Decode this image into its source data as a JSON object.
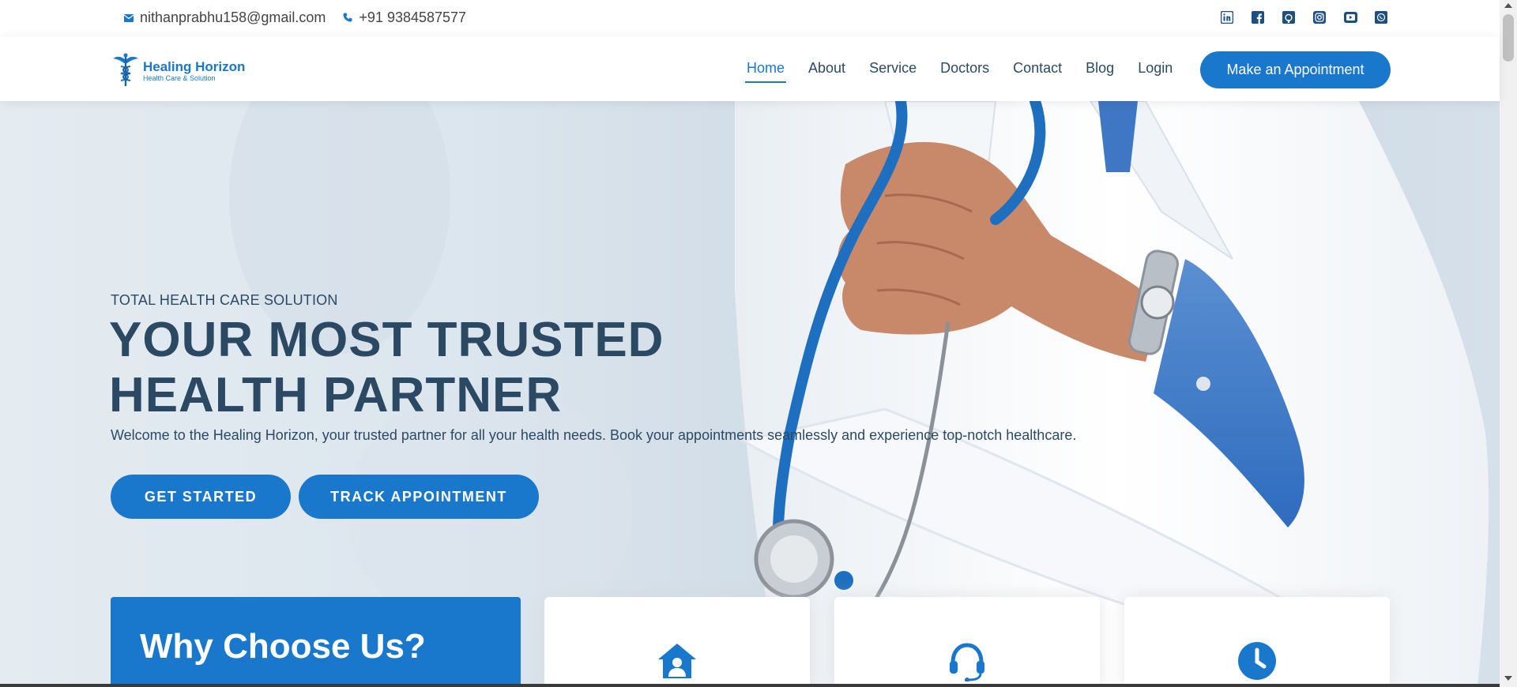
{
  "topbar": {
    "email": "nithanprabhu158@gmail.com",
    "phone": "+91 9384587577",
    "socials": [
      "linkedin-icon",
      "facebook-icon",
      "github-icon",
      "instagram-icon",
      "youtube-icon",
      "whatsapp-icon"
    ]
  },
  "header": {
    "logo_name": "Healing Horizon",
    "logo_tagline": "Health Care & Solution",
    "nav": [
      {
        "label": "Home",
        "active": true
      },
      {
        "label": "About"
      },
      {
        "label": "Service"
      },
      {
        "label": "Doctors"
      },
      {
        "label": "Contact"
      },
      {
        "label": "Blog"
      },
      {
        "label": "Login"
      }
    ],
    "cta": "Make an Appointment"
  },
  "hero": {
    "eyebrow": "TOTAL HEALTH CARE SOLUTION",
    "title_line1": "YOUR MOST TRUSTED",
    "title_line2": "HEALTH PARTNER",
    "lead": "Welcome to the Healing Horizon, your trusted partner for all your health needs. Book your appointments seamlessly and experience top-notch healthcare.",
    "btn_start": "GET STARTED",
    "btn_track": "TRACK APPOINTMENT"
  },
  "why": {
    "title": "Why Choose Us?",
    "cards": [
      "home-user-icon",
      "headset-icon",
      "clock-icon"
    ]
  },
  "colors": {
    "accent": "#1977cc",
    "heading": "#2c4964"
  }
}
